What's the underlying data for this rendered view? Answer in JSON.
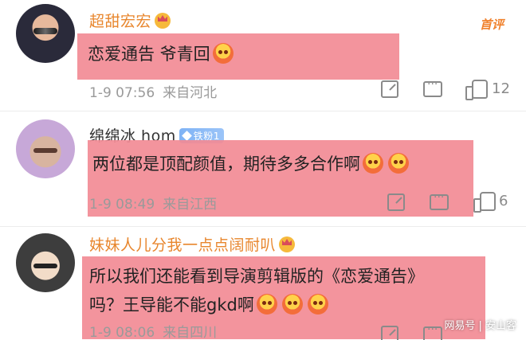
{
  "comments": [
    {
      "username": "超甜宏宏",
      "content": "恋爱通告 爷青回",
      "date": "1-9 07:56",
      "source": "来自河北",
      "likes": "12",
      "tag": "首评"
    },
    {
      "username": "绵绵冰 hom",
      "fan_badge": "铁粉1",
      "content": "两位都是顶配颜值，期待多多合作啊",
      "date": "1-9 08:49",
      "source": "来自江西",
      "likes": "6"
    },
    {
      "username": "妹妹人儿分我一点点阔耐叭",
      "content_line1": "所以我们还能看到导演剪辑版的《恋爱通告》",
      "content_line2": "吗？王导能不能gkd啊",
      "date": "1-9 08:06",
      "source": "来自四川"
    }
  ],
  "watermark": "网易号 | 安山客"
}
